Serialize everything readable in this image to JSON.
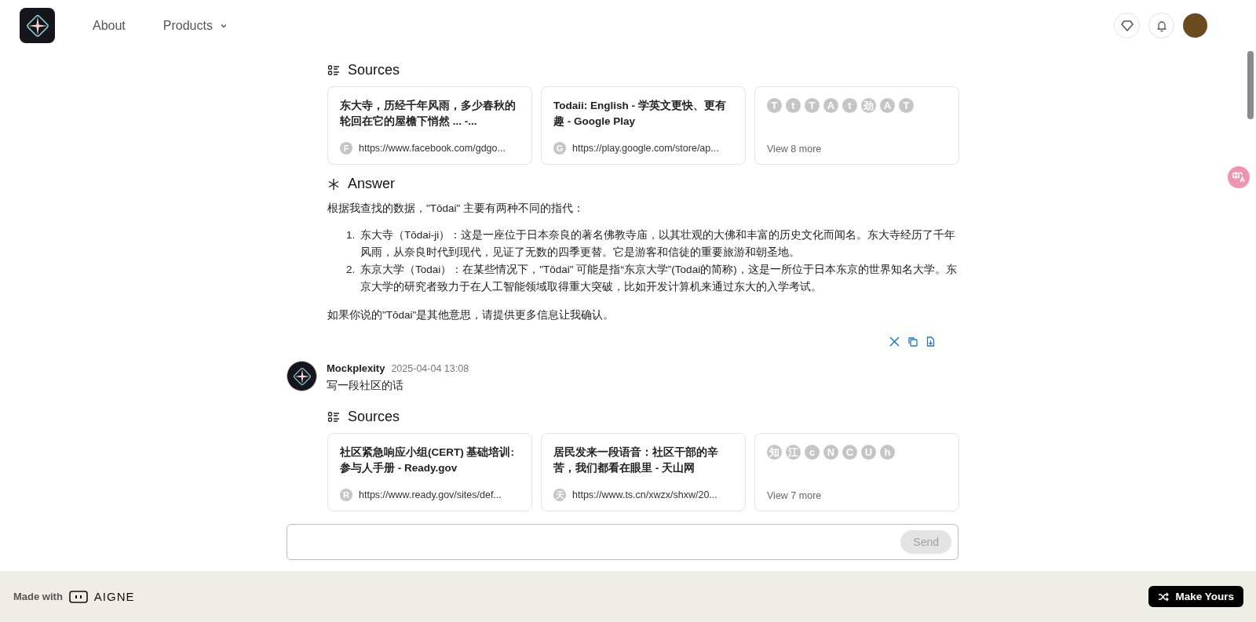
{
  "nav": {
    "links": [
      {
        "label": "About",
        "dropdown": false
      },
      {
        "label": "Products",
        "dropdown": true
      }
    ]
  },
  "blocks": [
    {
      "kind": "sources",
      "title": "Sources",
      "cards": [
        {
          "title": "东大寺，历经千年风雨，多少春秋的轮回在它的屋檐下悄然 ... -...",
          "favicon": "F",
          "url": "https://www.facebook.com/gdgo..."
        },
        {
          "title": "Todaii: English - 学英文更快、更有趣 - Google Play",
          "favicon": "G",
          "url": "https://play.google.com/store/ap..."
        }
      ],
      "more": {
        "favicons": [
          "T",
          "t",
          "T",
          "A",
          "t",
          "劲",
          "A",
          "T"
        ],
        "label": "View 8 more"
      }
    },
    {
      "kind": "answer",
      "title": "Answer",
      "intro": "根据我查找的数据，\"Tōdai\" 主要有两种不同的指代：",
      "items": [
        {
          "marker": "1.",
          "text": "东大寺（Tōdai-ji）：这是一座位于日本奈良的著名佛教寺庙，以其壮观的大佛和丰富的历史文化而闻名。东大寺经历了千年风雨，从奈良时代到现代，见证了无数的四季更替。它是游客和信徒的重要旅游和朝圣地。"
        },
        {
          "marker": "2.",
          "text": "东京大学（Todai）：在某些情况下，\"Tōdai\" 可能是指“东京大学”(Todai的简称)，这是一所位于日本东京的世界知名大学。东京大学的研究者致力于在人工智能领域取得重大突破，比如开发计算机来通过东大的入学考试。"
        }
      ],
      "outro": "如果你说的\"Tōdai\"是其他意思，请提供更多信息让我确认。"
    },
    {
      "kind": "message",
      "author": "Mockplexity",
      "time": "2025-04-04 13:08",
      "text": "写一段社区的话"
    },
    {
      "kind": "sources",
      "title": "Sources",
      "cards": [
        {
          "title": "社区紧急响应小组(CERT) 基础培训: 参与人手册 - Ready.gov",
          "favicon": "R",
          "url": "https://www.ready.gov/sites/def..."
        },
        {
          "title": "居民发来一段语音：社区干部的辛苦，我们都看在眼里 - 天山网",
          "favicon": "天",
          "url": "https://www.ts.cn/xwzx/shxw/20..."
        }
      ],
      "more": {
        "favicons": [
          "知",
          "江",
          "c",
          "N",
          "C",
          "U",
          "h"
        ],
        "label": "View 7 more"
      }
    }
  ],
  "composer": {
    "button": "Send",
    "disabled": true
  },
  "footer": {
    "made_with": "Made with",
    "brand": "AIGNE",
    "cta": "Make Yours"
  }
}
